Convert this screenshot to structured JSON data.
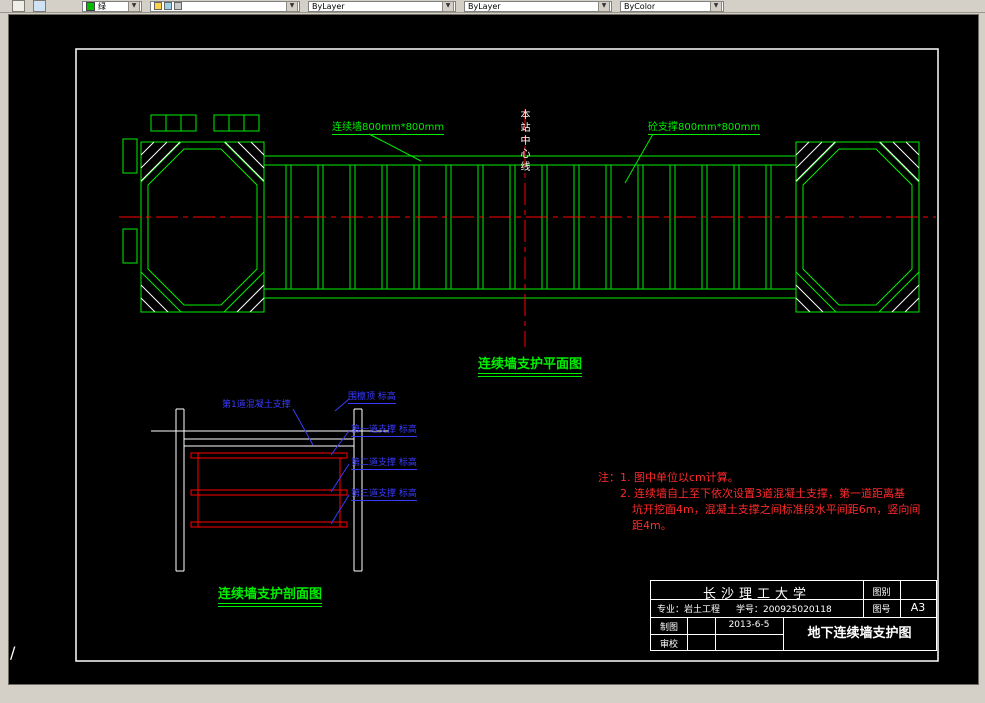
{
  "toolbar": {
    "color_value": "绿",
    "layer_value": "",
    "linetype_value": "ByLayer",
    "lineweight_value": "ByLayer",
    "plotstyle_value": "ByColor",
    "arrow_glyph": "▼"
  },
  "plan": {
    "wall_label": "连续墙800mm*800mm",
    "centerline_label": "本站中心线",
    "strut_label": "砼支撑800mm*800mm",
    "title": "连续墙支护平面图"
  },
  "section": {
    "title": "连续墙支护剖面图",
    "cap_label": "第1道混凝土支撑",
    "level_labels": [
      "围檩顶 标高",
      "第一道支撑 标高",
      "第二道支撑 标高",
      "第三道支撑 标高"
    ]
  },
  "notes": {
    "line1": "注：1. 图中单位以cm计算。",
    "line2": "2. 连续墙自上至下依次设置3道混凝土支撑，第一道距离基",
    "line3": "坑开挖面4m，混凝土支撑之间标准段水平间距6m，竖向间",
    "line4": "距4m。"
  },
  "titleblock": {
    "university": "长沙理工大学",
    "major": "专业：岩土工程",
    "student_id": "学号：200925020118",
    "sheet_type_label": "图别",
    "sheet_no_label": "图号",
    "sheet_no": "A3",
    "drafter_label": "制图",
    "checker_label": "审校",
    "date": "2013-6-5",
    "drawing_title": "地下连续墙支护图"
  },
  "misc": {
    "command_hint": "/"
  },
  "colors": {
    "cad_green": "#00ee00",
    "cad_red": "#ff0000",
    "cad_blue": "#3a3aff",
    "cad_white": "#ffffff",
    "chrome_gray": "#d4d0c8",
    "canvas_black": "#000000"
  }
}
